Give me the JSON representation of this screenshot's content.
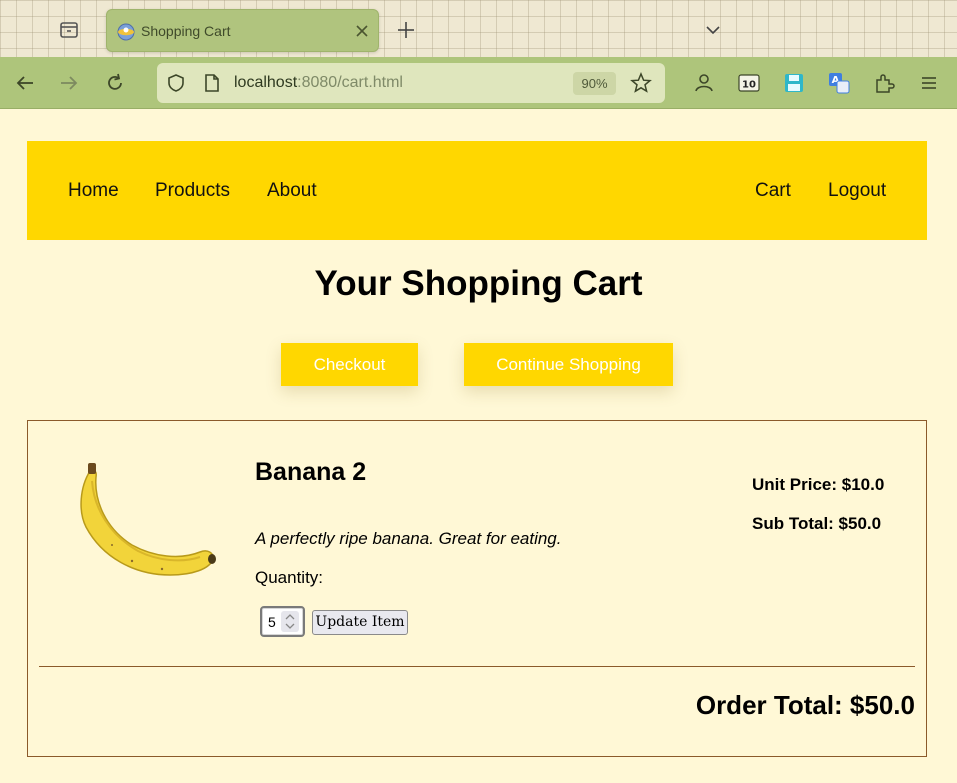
{
  "browser": {
    "tab_title": "Shopping Cart",
    "url_host": "localhost",
    "url_rest": ":8080/cart.html",
    "zoom": "90%"
  },
  "site_nav": {
    "home": "Home",
    "products": "Products",
    "about": "About",
    "cart": "Cart",
    "logout": "Logout"
  },
  "page": {
    "title": "Your Shopping Cart",
    "checkout_label": "Checkout",
    "continue_label": "Continue Shopping"
  },
  "cart": {
    "items": [
      {
        "name": "Banana 2",
        "description": "A perfectly ripe banana. Great for eating.",
        "quantity_label": "Quantity:",
        "quantity": "5",
        "update_label": "Update Item",
        "unit_price": "Unit Price: $10.0",
        "sub_total": "Sub Total: $50.0"
      }
    ],
    "order_total": "Order Total: $50.0"
  },
  "colors": {
    "accent": "#ffd700",
    "page_bg": "#fff8d6",
    "border": "#8b5a2b",
    "browser_toolbar": "#aec57b"
  }
}
